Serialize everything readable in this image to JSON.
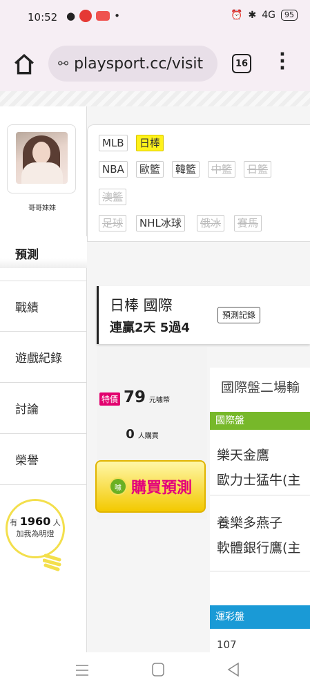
{
  "status": {
    "time": "10:52",
    "network": "4G",
    "battery": "95"
  },
  "browser": {
    "url": "playsport.cc/visit",
    "tab_count": "16"
  },
  "user": {
    "name": "哥哥妹妹"
  },
  "nav": {
    "predict": "預測",
    "items": [
      "戰績",
      "遊戲紀錄",
      "討論",
      "榮譽"
    ]
  },
  "light": {
    "prefix": "有",
    "count": "1960",
    "suffix": "人",
    "line2": "加我為明燈"
  },
  "leagues": [
    {
      "label": "MLB",
      "state": "normal"
    },
    {
      "label": "日棒",
      "state": "active"
    },
    {
      "label": "NBA",
      "state": "normal"
    },
    {
      "label": "歐籃",
      "state": "normal"
    },
    {
      "label": "韓籃",
      "state": "normal"
    },
    {
      "label": "中籃",
      "state": "disabled"
    },
    {
      "label": "日籃",
      "state": "disabled"
    },
    {
      "label": "澳籃",
      "state": "disabled"
    },
    {
      "label": "足球",
      "state": "disabled"
    },
    {
      "label": "NHL冰球",
      "state": "normal"
    },
    {
      "label": "俄冰",
      "state": "disabled"
    },
    {
      "label": "賽馬",
      "state": "disabled"
    }
  ],
  "prediction": {
    "line1": "日棒 國際",
    "line2": "連贏2天 5過4",
    "record_button": "預測記錄"
  },
  "price": {
    "badge": "特價",
    "amount": "79",
    "unit": "元噱幣"
  },
  "buyers": {
    "count": "0",
    "unit": "人購買"
  },
  "buy_button": {
    "label": "購買預測",
    "coin": "噱"
  },
  "games": {
    "title": "國際盤二場輸",
    "section1": "國際盤",
    "section2": "運彩盤",
    "matches": [
      {
        "home": "樂天金鷹",
        "away": "歐力士猛牛(主"
      },
      {
        "home": "養樂多燕子",
        "away": "軟體銀行鷹(主"
      }
    ],
    "partial": "107"
  },
  "colors": {
    "green": "#77b82a",
    "blue": "#1a9ad6",
    "accent": "#e3007b"
  }
}
